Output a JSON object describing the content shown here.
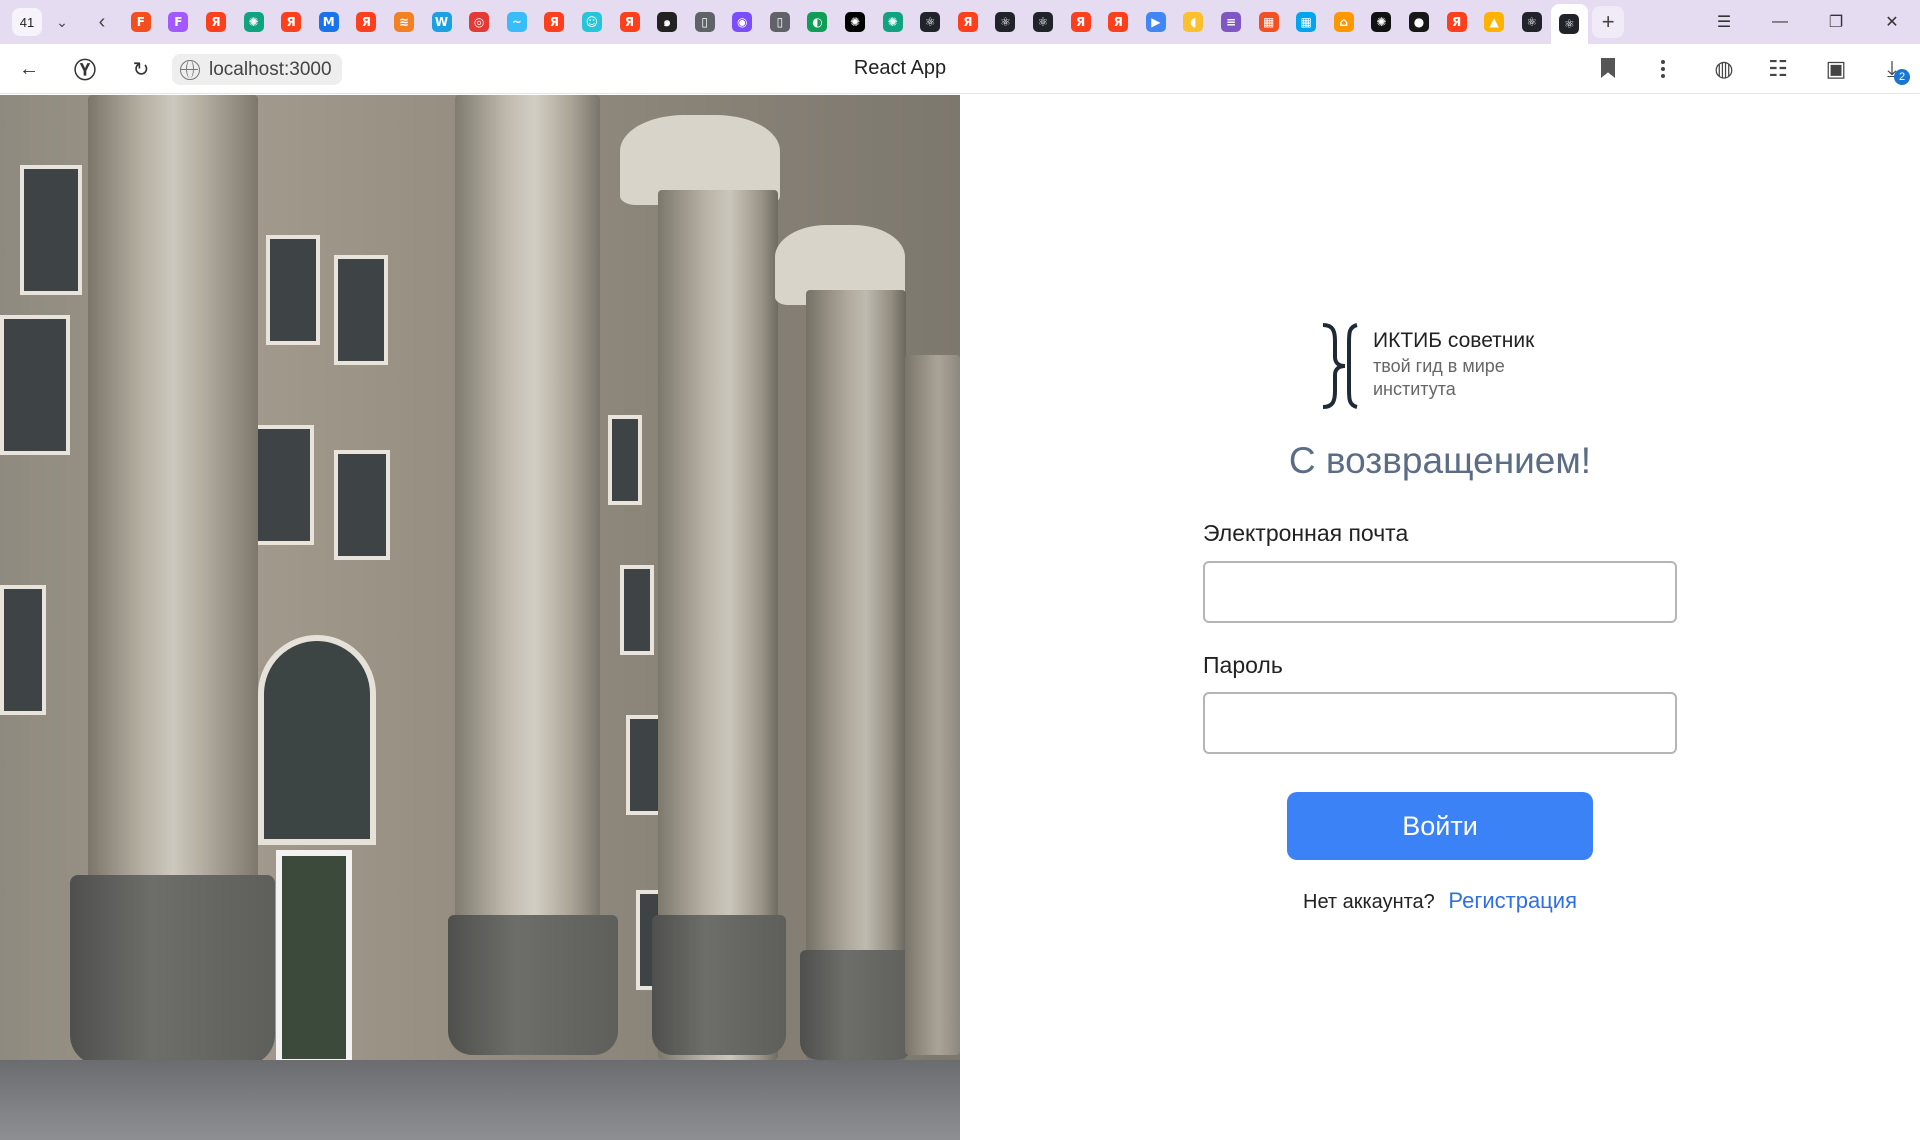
{
  "browser": {
    "tab_count": "41",
    "pinned_tabs": [
      {
        "icon": "figma-icon",
        "glyph": "F",
        "color": "#f24e1e"
      },
      {
        "icon": "figma-icon",
        "glyph": "F",
        "color": "#a259ff"
      },
      {
        "icon": "yandex-icon",
        "glyph": "Я",
        "color": "#fc3f1d"
      },
      {
        "icon": "chatgpt-icon",
        "glyph": "✺",
        "color": "#10a37f"
      },
      {
        "icon": "yandex-icon",
        "glyph": "Я",
        "color": "#fc3f1d"
      },
      {
        "icon": "bookmark-app-icon",
        "glyph": "M",
        "color": "#1a73e8"
      },
      {
        "icon": "yandex-icon",
        "glyph": "Я",
        "color": "#fc3f1d"
      },
      {
        "icon": "stack-icon",
        "glyph": "≋",
        "color": "#f48024"
      },
      {
        "icon": "word-icon",
        "glyph": "W",
        "color": "#1ba1e2"
      },
      {
        "icon": "target-icon",
        "glyph": "◎",
        "color": "#e53935"
      },
      {
        "icon": "tailwind-icon",
        "glyph": "~",
        "color": "#38bdf8"
      },
      {
        "icon": "yandex-icon",
        "glyph": "Я",
        "color": "#fc3f1d"
      },
      {
        "icon": "bot-icon",
        "glyph": "☺",
        "color": "#26c6da"
      },
      {
        "icon": "yandex-icon",
        "glyph": "Я",
        "color": "#fc3f1d"
      },
      {
        "icon": "swirl-icon",
        "glyph": "๑",
        "color": "#222222"
      },
      {
        "icon": "document-icon",
        "glyph": "▯",
        "color": "#5f6368"
      },
      {
        "icon": "search-app-icon",
        "glyph": "◉",
        "color": "#7c4dff"
      },
      {
        "icon": "document-icon",
        "glyph": "▯",
        "color": "#5f6368"
      },
      {
        "icon": "figma-alt-icon",
        "glyph": "◐",
        "color": "#0f9d58"
      },
      {
        "icon": "chatgpt-dark-icon",
        "glyph": "✺",
        "color": "#000000"
      },
      {
        "icon": "chatgpt-icon",
        "glyph": "✺",
        "color": "#10a37f"
      },
      {
        "icon": "react-icon",
        "glyph": "⚛",
        "color": "#20232a"
      },
      {
        "icon": "yandex-icon",
        "glyph": "Я",
        "color": "#fc3f1d"
      },
      {
        "icon": "react-icon",
        "glyph": "⚛",
        "color": "#20232a"
      },
      {
        "icon": "react-icon",
        "glyph": "⚛",
        "color": "#20232a"
      },
      {
        "icon": "yandex-icon",
        "glyph": "Я",
        "color": "#fc3f1d"
      },
      {
        "icon": "yandex-icon",
        "glyph": "Я",
        "color": "#fc3f1d"
      },
      {
        "icon": "play-icon",
        "glyph": "▶",
        "color": "#4285f4"
      },
      {
        "icon": "duck-icon",
        "glyph": "◖",
        "color": "#fbc02d"
      },
      {
        "icon": "layers-icon",
        "glyph": "≡",
        "color": "#7e57c2"
      },
      {
        "icon": "microsoft-icon",
        "glyph": "▦",
        "color": "#f25022"
      },
      {
        "icon": "microsoft-icon",
        "glyph": "▦",
        "color": "#00a4ef"
      },
      {
        "icon": "home-icon",
        "glyph": "⌂",
        "color": "#ff9800"
      },
      {
        "icon": "openai-icon",
        "glyph": "✺",
        "color": "#111111"
      },
      {
        "icon": "github-icon",
        "glyph": "●",
        "color": "#181717"
      },
      {
        "icon": "yandex-icon",
        "glyph": "Я",
        "color": "#fc3f1d"
      },
      {
        "icon": "image-icon",
        "glyph": "▲",
        "color": "#ffb300"
      },
      {
        "icon": "react-icon",
        "glyph": "⚛",
        "color": "#20232a"
      },
      {
        "icon": "react-icon",
        "glyph": "⚛",
        "color": "#20232a"
      }
    ],
    "address": "localhost:3000",
    "page_title": "React App",
    "downloads_count": "2"
  },
  "login": {
    "logo_title": "ИКТИБ советник",
    "logo_subtitle_line1": "твой гид в мире",
    "logo_subtitle_line2": "института",
    "heading": "С возвращением!",
    "email_label": "Электронная почта",
    "email_value": "",
    "password_label": "Пароль",
    "password_value": "",
    "submit_label": "Войти",
    "signup_prompt": "Нет аккаунта?",
    "signup_link": "Регистрация"
  },
  "colors": {
    "accent": "#3b82f6",
    "link": "#2f6fe4",
    "heading": "#5a6d85",
    "tabstrip": "#e6dcf2"
  }
}
